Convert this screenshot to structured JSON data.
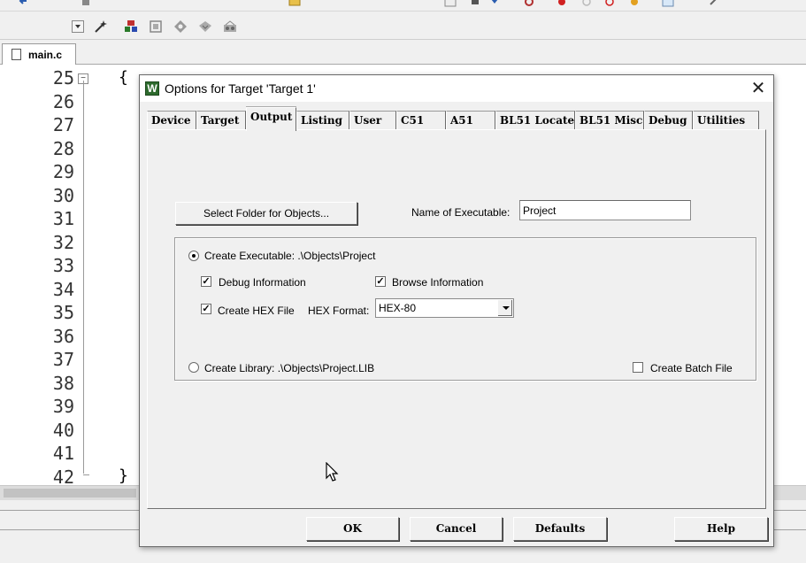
{
  "editor": {
    "file_tab": "main.c",
    "line_numbers": [
      "25",
      "26",
      "27",
      "28",
      "29",
      "30",
      "31",
      "32",
      "33",
      "34",
      "35",
      "36",
      "37",
      "38",
      "39",
      "40",
      "41",
      "42"
    ],
    "open_brace": "{",
    "close_brace": "}",
    "fold_symbol": "−"
  },
  "dialog": {
    "title": "Options for Target 'Target 1'",
    "app_icon": "W",
    "close_glyph": "✕",
    "tabs": [
      "Device",
      "Target",
      "Output",
      "Listing",
      "User",
      "C51",
      "A51",
      "BL51 Locate",
      "BL51 Misc",
      "Debug",
      "Utilities"
    ],
    "active_tab": "Output",
    "select_folder_button": "Select Folder for Objects...",
    "name_of_executable_label": "Name of Executable:",
    "name_of_executable_value": "Project",
    "create_executable_label": "Create Executable:  .\\Objects\\Project",
    "create_executable_selected": true,
    "debug_information_label": "Debug Information",
    "debug_information_checked": true,
    "browse_information_label": "Browse Information",
    "browse_information_checked": true,
    "create_hex_label": "Create HEX File",
    "create_hex_checked": true,
    "hex_format_label": "HEX Format:",
    "hex_format_value": "HEX-80",
    "create_library_label": "Create Library:  .\\Objects\\Project.LIB",
    "create_library_selected": false,
    "create_batch_label": "Create Batch File",
    "create_batch_checked": false,
    "check_glyph": "✓",
    "buttons": {
      "ok": "OK",
      "cancel": "Cancel",
      "defaults": "Defaults",
      "help": "Help"
    }
  },
  "toolbar2_icons": [
    "dropdown-icon",
    "magic-wand-icon",
    "manage-components-icon",
    "select-packs-icon",
    "pack-installer-icon",
    "manage-runtime-icon",
    "books-icon"
  ]
}
